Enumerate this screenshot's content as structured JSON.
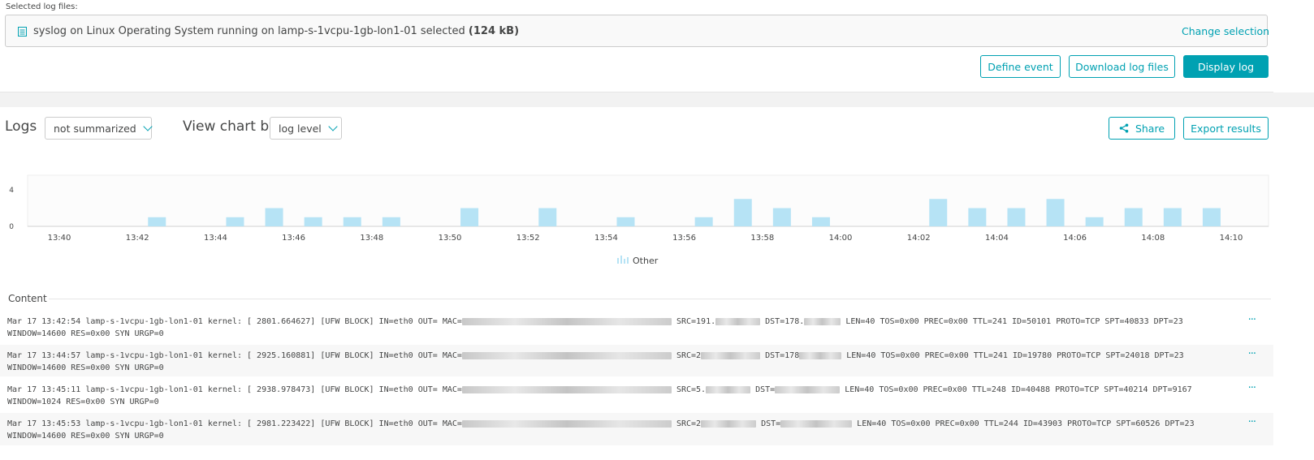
{
  "selection": {
    "label": "Selected log files:",
    "file_text": "syslog on Linux Operating System running on lamp-s-1vcpu-1gb-lon1-01 selected",
    "size": "(124 kB)",
    "change_link": "Change selection",
    "icon": "log-file-icon"
  },
  "actions": {
    "define_event": "Define event",
    "download": "Download log files",
    "display": "Display log"
  },
  "logs_toolbar": {
    "title": "Logs",
    "summarize_value": "not summarized",
    "view_chart_label": "View chart by",
    "chart_by_value": "log level",
    "share": "Share",
    "export": "Export results",
    "share_icon": "share-icon"
  },
  "chart_data": {
    "type": "bar",
    "categories": [
      "13:40",
      "13:41",
      "13:42",
      "13:43",
      "13:44",
      "13:45",
      "13:46",
      "13:47",
      "13:48",
      "13:49",
      "13:50",
      "13:51",
      "13:52",
      "13:53",
      "13:54",
      "13:55",
      "13:56",
      "13:57",
      "13:58",
      "13:59",
      "14:00",
      "14:01",
      "14:02",
      "14:03",
      "14:04",
      "14:05",
      "14:06",
      "14:07",
      "14:08",
      "14:09",
      "14:10"
    ],
    "series": [
      {
        "name": "Other",
        "values": [
          0,
          0,
          1,
          0,
          1,
          2,
          1,
          1,
          1,
          0,
          2,
          0,
          2,
          0,
          1,
          0,
          1,
          3,
          2,
          1,
          0,
          0,
          3,
          2,
          2,
          3,
          1,
          2,
          2,
          2,
          0
        ]
      }
    ],
    "x_tick_labels": [
      "13:40",
      "13:42",
      "13:44",
      "13:46",
      "13:48",
      "13:50",
      "13:52",
      "13:54",
      "13:56",
      "13:58",
      "14:00",
      "14:02",
      "14:04",
      "14:06",
      "14:08",
      "14:10"
    ],
    "y_tick_labels": [
      "0",
      "4"
    ],
    "ylim": [
      0,
      4
    ],
    "color": "#b6e3f5",
    "legend_position": "bottom-center",
    "grid": false
  },
  "content": {
    "label": "Content",
    "more_label": "···",
    "rows": [
      {
        "p1": "Mar 17 13:42:54 lamp-s-1vcpu-1gb-lon1-01 kernel: [ 2801.664627] [UFW BLOCK] IN=eth0 OUT= MAC=",
        "p2": " SRC=191.",
        "p3": " DST=178.",
        "p4": " LEN=40 TOS=0x00 PREC=0x00 TTL=241 ID=50101 PROTO=TCP SPT=40833 DPT=23 WINDOW=14600 RES=0x00 SYN URGP=0"
      },
      {
        "p1": "Mar 17 13:44:57 lamp-s-1vcpu-1gb-lon1-01 kernel: [ 2925.160881] [UFW BLOCK] IN=eth0 OUT= MAC=",
        "p2": " SRC=2",
        "p3": " DST=178",
        "p4": " LEN=40 TOS=0x00 PREC=0x00 TTL=241 ID=19780 PROTO=TCP SPT=24018 DPT=23 WINDOW=14600 RES=0x00 SYN URGP=0"
      },
      {
        "p1": "Mar 17 13:45:11 lamp-s-1vcpu-1gb-lon1-01 kernel: [ 2938.978473] [UFW BLOCK] IN=eth0 OUT= MAC=",
        "p2": " SRC=5.",
        "p3": " DST=",
        "p4": " LEN=40 TOS=0x00 PREC=0x00 TTL=248 ID=40488 PROTO=TCP SPT=40214 DPT=9167 WINDOW=1024 RES=0x00 SYN URGP=0"
      },
      {
        "p1": "Mar 17 13:45:53 lamp-s-1vcpu-1gb-lon1-01 kernel: [ 2981.223422] [UFW BLOCK] IN=eth0 OUT= MAC=",
        "p2": " SRC=2",
        "p3": " DST=",
        "p4": " LEN=40 TOS=0x00 PREC=0x00 TTL=244 ID=43903 PROTO=TCP SPT=60526 DPT=23 WINDOW=14600 RES=0x00 SYN URGP=0"
      }
    ]
  }
}
